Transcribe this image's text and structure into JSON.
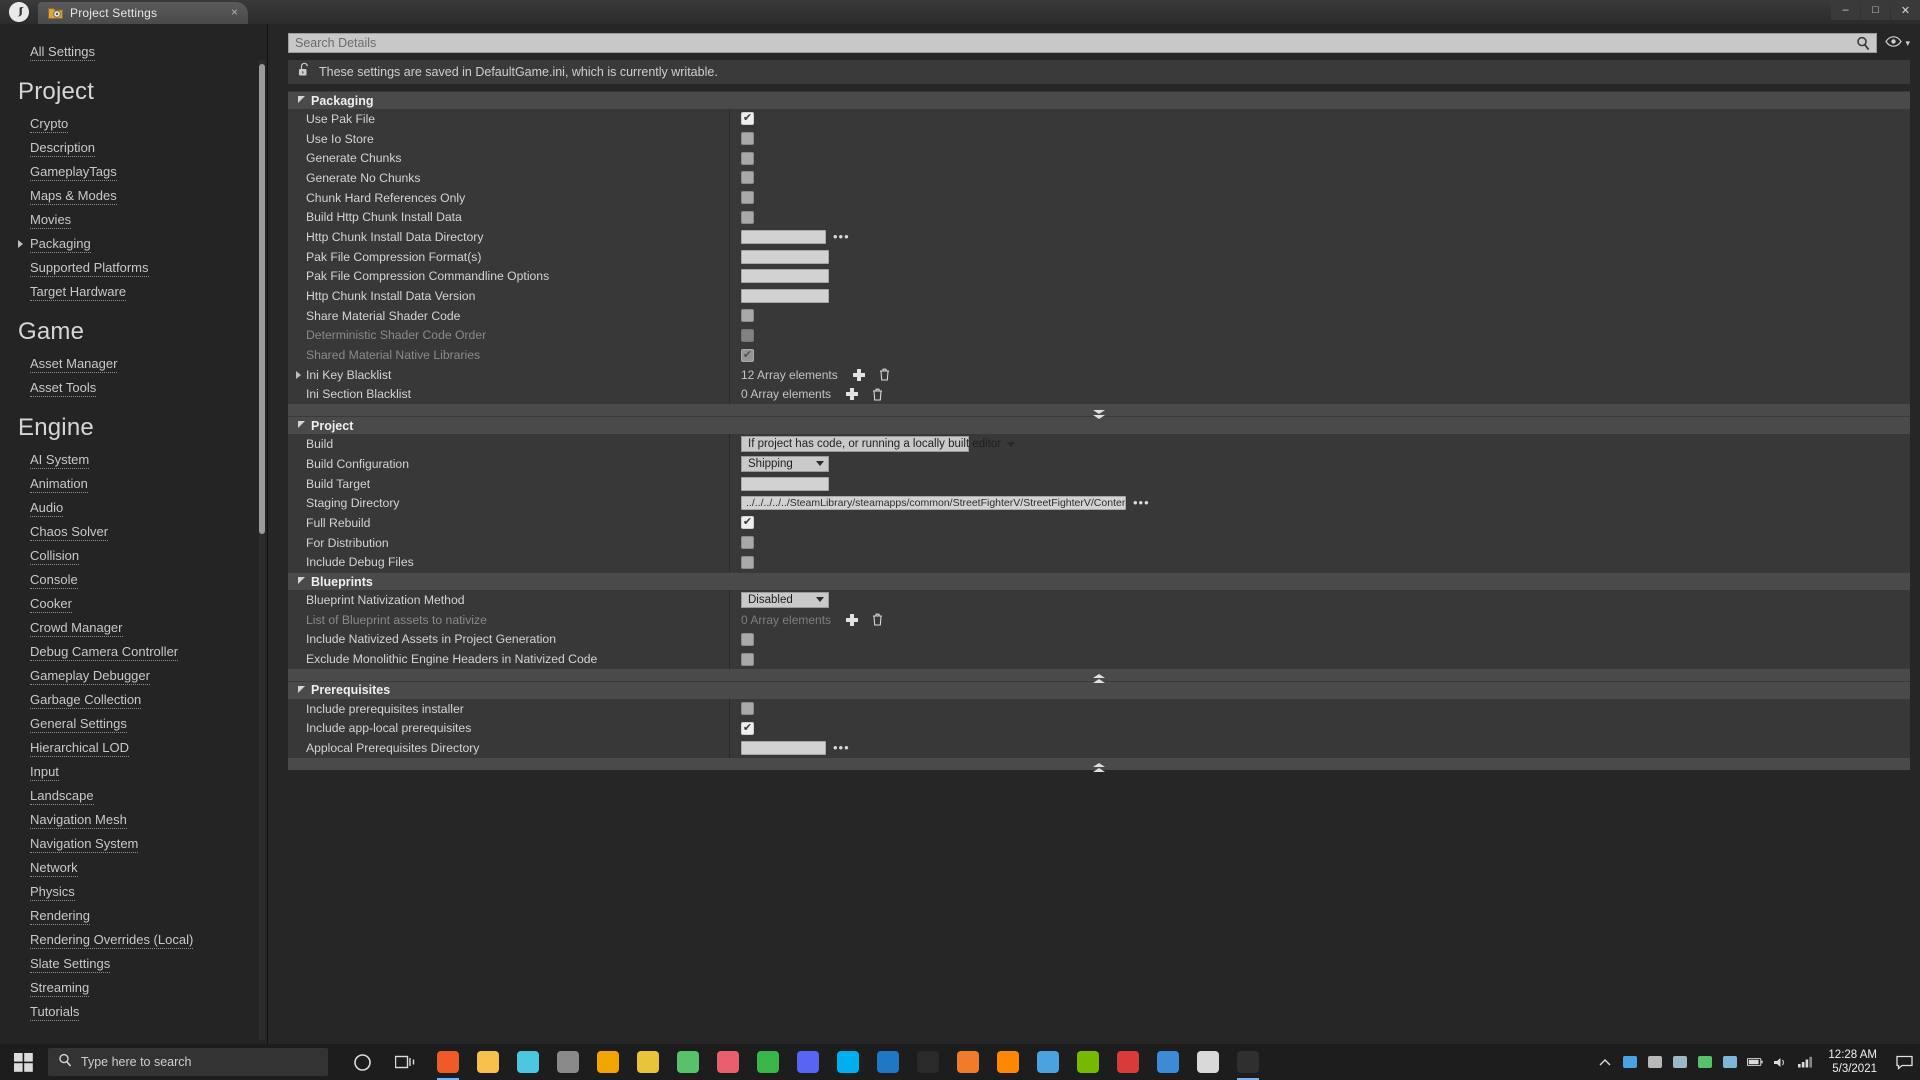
{
  "window": {
    "tab_title": "Project Settings",
    "tab_icon": "folder-gear-icon",
    "close_glyph": "×",
    "minimize_glyph": "–",
    "maximize_glyph": "□",
    "win_close_glyph": "✕"
  },
  "search": {
    "placeholder": "Search Details",
    "icon": "magnifier-icon",
    "eye_icon": "eye-icon",
    "eye_caret": "▾"
  },
  "notice": {
    "icon": "unlocked-padlock-icon",
    "text": "These settings are saved in DefaultGame.ini, which is currently writable."
  },
  "sidebar": {
    "all_settings": "All Settings",
    "groups": [
      {
        "heading": "Project",
        "items": [
          {
            "label": "Crypto",
            "expandable": false
          },
          {
            "label": "Description",
            "expandable": false
          },
          {
            "label": "GameplayTags",
            "expandable": false
          },
          {
            "label": "Maps & Modes",
            "expandable": false
          },
          {
            "label": "Movies",
            "expandable": false
          },
          {
            "label": "Packaging",
            "expandable": true
          },
          {
            "label": "Supported Platforms",
            "expandable": false
          },
          {
            "label": "Target Hardware",
            "expandable": false
          }
        ]
      },
      {
        "heading": "Game",
        "items": [
          {
            "label": "Asset Manager",
            "expandable": false
          },
          {
            "label": "Asset Tools",
            "expandable": false
          }
        ]
      },
      {
        "heading": "Engine",
        "items": [
          {
            "label": "AI System",
            "expandable": false
          },
          {
            "label": "Animation",
            "expandable": false
          },
          {
            "label": "Audio",
            "expandable": false
          },
          {
            "label": "Chaos Solver",
            "expandable": false
          },
          {
            "label": "Collision",
            "expandable": false
          },
          {
            "label": "Console",
            "expandable": false
          },
          {
            "label": "Cooker",
            "expandable": false
          },
          {
            "label": "Crowd Manager",
            "expandable": false
          },
          {
            "label": "Debug Camera Controller",
            "expandable": false
          },
          {
            "label": "Gameplay Debugger",
            "expandable": false
          },
          {
            "label": "Garbage Collection",
            "expandable": false
          },
          {
            "label": "General Settings",
            "expandable": false
          },
          {
            "label": "Hierarchical LOD",
            "expandable": false
          },
          {
            "label": "Input",
            "expandable": false
          },
          {
            "label": "Landscape",
            "expandable": false
          },
          {
            "label": "Navigation Mesh",
            "expandable": false
          },
          {
            "label": "Navigation System",
            "expandable": false
          },
          {
            "label": "Network",
            "expandable": false
          },
          {
            "label": "Physics",
            "expandable": false
          },
          {
            "label": "Rendering",
            "expandable": false
          },
          {
            "label": "Rendering Overrides (Local)",
            "expandable": false
          },
          {
            "label": "Slate Settings",
            "expandable": false
          },
          {
            "label": "Streaming",
            "expandable": false
          },
          {
            "label": "Tutorials",
            "expandable": false
          }
        ]
      }
    ]
  },
  "sections": [
    {
      "name": "Packaging",
      "expanded": true,
      "rows": [
        {
          "label": "Use Pak File",
          "type": "checkbox",
          "checked": true,
          "disabled": false
        },
        {
          "label": "Use Io Store",
          "type": "checkbox",
          "checked": false,
          "disabled": false
        },
        {
          "label": "Generate Chunks",
          "type": "checkbox",
          "checked": false,
          "disabled": false
        },
        {
          "label": "Generate No Chunks",
          "type": "checkbox",
          "checked": false,
          "disabled": false
        },
        {
          "label": "Chunk Hard References Only",
          "type": "checkbox",
          "checked": false,
          "disabled": false
        },
        {
          "label": "Build Http Chunk Install Data",
          "type": "checkbox",
          "checked": false,
          "disabled": false
        },
        {
          "label": "Http Chunk Install Data Directory",
          "type": "path",
          "value": "",
          "browse": "•••"
        },
        {
          "label": "Pak File Compression Format(s)",
          "type": "text",
          "value": ""
        },
        {
          "label": "Pak File Compression Commandline Options",
          "type": "text",
          "value": ""
        },
        {
          "label": "Http Chunk Install Data Version",
          "type": "text",
          "value": ""
        },
        {
          "label": "Share Material Shader Code",
          "type": "checkbox",
          "checked": false,
          "disabled": false
        },
        {
          "label": "Deterministic Shader Code Order",
          "type": "checkbox",
          "checked": false,
          "disabled": true
        },
        {
          "label": "Shared Material Native Libraries",
          "type": "checkbox",
          "checked": true,
          "disabled": true
        },
        {
          "label": "Ini Key Blacklist",
          "type": "array",
          "value": "12 Array elements",
          "expandable": true,
          "disabled": false
        },
        {
          "label": "Ini Section Blacklist",
          "type": "array",
          "value": "0 Array elements",
          "expandable": false,
          "disabled": false
        }
      ],
      "footer_icon": "collapse-down-icon"
    },
    {
      "name": "Project",
      "expanded": true,
      "rows": [
        {
          "label": "Build",
          "type": "dropdown",
          "value": "If project has code, or running a locally built editor",
          "width": "wide"
        },
        {
          "label": "Build Configuration",
          "type": "dropdown",
          "value": "Shipping",
          "width": "narrow"
        },
        {
          "label": "Build Target",
          "type": "text",
          "value": ""
        },
        {
          "label": "Staging Directory",
          "type": "path",
          "value": "../../../../../SteamLibrary/steamapps/common/StreetFighterV/StreetFighterV/Content/Paks",
          "browse": "•••"
        },
        {
          "label": "Full Rebuild",
          "type": "checkbox",
          "checked": true,
          "disabled": false
        },
        {
          "label": "For Distribution",
          "type": "checkbox",
          "checked": false,
          "disabled": false
        },
        {
          "label": "Include Debug Files",
          "type": "checkbox",
          "checked": false,
          "disabled": false
        }
      ]
    },
    {
      "name": "Blueprints",
      "expanded": true,
      "rows": [
        {
          "label": "Blueprint Nativization Method",
          "type": "dropdown",
          "value": "Disabled",
          "width": "narrow"
        },
        {
          "label": "List of Blueprint assets to nativize",
          "type": "array",
          "value": "0 Array elements",
          "expandable": false,
          "disabled": true
        },
        {
          "label": "Include Nativized Assets in Project Generation",
          "type": "checkbox",
          "checked": false,
          "disabled": false
        },
        {
          "label": "Exclude Monolithic Engine Headers in Nativized Code",
          "type": "checkbox",
          "checked": false,
          "disabled": false
        }
      ],
      "footer_icon": "collapse-up-icon"
    },
    {
      "name": "Prerequisites",
      "expanded": true,
      "rows": [
        {
          "label": "Include prerequisites installer",
          "type": "checkbox",
          "checked": false,
          "disabled": false
        },
        {
          "label": "Include app-local prerequisites",
          "type": "checkbox",
          "checked": true,
          "disabled": false
        },
        {
          "label": "Applocal Prerequisites Directory",
          "type": "path",
          "value": "",
          "browse": "•••"
        }
      ],
      "footer_icon": "collapse-up-icon"
    }
  ],
  "taskbar": {
    "search_placeholder": "Type here to search",
    "search_icon": "magnifier-icon",
    "start_icon": "windows-start-icon",
    "cortana_icon": "cortana-circle-icon",
    "taskview_icon": "task-view-icon",
    "apps": [
      {
        "name": "brave-browser-icon",
        "color": "#f05a28"
      },
      {
        "name": "file-explorer-icon",
        "color": "#f7c04a"
      },
      {
        "name": "sticky-notes-icon",
        "color": "#4ec6e0"
      },
      {
        "name": "settings-gear-icon",
        "color": "#8a8a8a"
      },
      {
        "name": "store-icon",
        "color": "#f0a500"
      },
      {
        "name": "chrome-icon",
        "color": "#e8c43a"
      },
      {
        "name": "todo-check-icon",
        "color": "#58c26a"
      },
      {
        "name": "itunes-music-icon",
        "color": "#e8606f"
      },
      {
        "name": "green-app-icon",
        "color": "#3ab54a"
      },
      {
        "name": "discord-icon",
        "color": "#5865f2"
      },
      {
        "name": "skype-icon",
        "color": "#00aff0"
      },
      {
        "name": "blue-tool-icon",
        "color": "#1f78c1"
      },
      {
        "name": "epic-games-icon",
        "color": "#2a2a2a"
      },
      {
        "name": "photoshop-icon",
        "color": "#f07c2b"
      },
      {
        "name": "vlc-cone-icon",
        "color": "#ff8800"
      },
      {
        "name": "media-player-icon",
        "color": "#4aa3df"
      },
      {
        "name": "nvidia-icon",
        "color": "#76b900"
      },
      {
        "name": "red-chart-icon",
        "color": "#d93b3b"
      },
      {
        "name": "blue-doc-icon",
        "color": "#3d8bd6"
      },
      {
        "name": "paint-icon",
        "color": "#d9d9d9"
      },
      {
        "name": "unreal-engine-icon",
        "color": "#2f2f2f"
      }
    ],
    "tray": [
      {
        "name": "chevron-up-icon"
      },
      {
        "name": "tray-blue-icon"
      },
      {
        "name": "onedrive-cloud-icon"
      },
      {
        "name": "cloud-icon"
      },
      {
        "name": "green-shield-icon"
      },
      {
        "name": "controller-icon"
      },
      {
        "name": "battery-icon"
      },
      {
        "name": "volume-icon"
      },
      {
        "name": "network-icon"
      }
    ],
    "clock_time": "12:28 AM",
    "clock_date": "5/3/2021",
    "notification_icon": "action-center-icon"
  }
}
